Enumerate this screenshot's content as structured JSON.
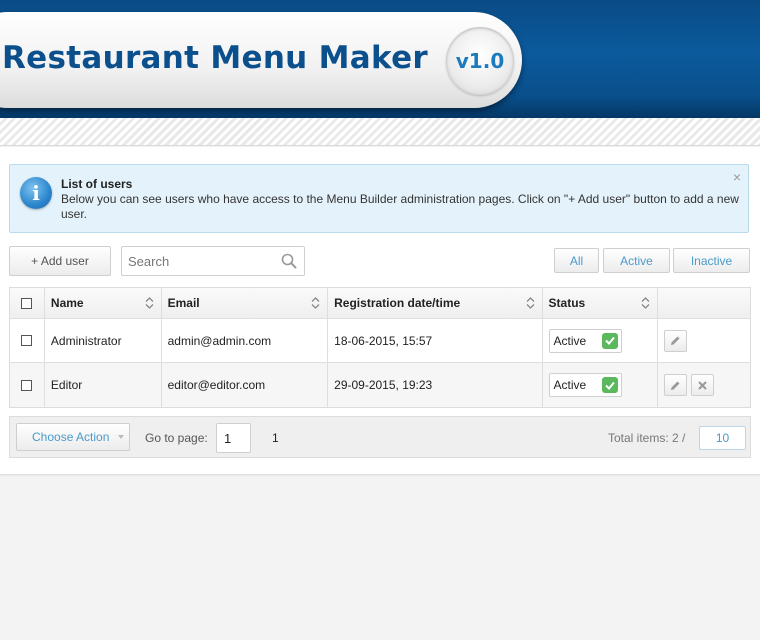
{
  "header": {
    "title": "Restaurant Menu Maker",
    "version": "v1.0"
  },
  "info": {
    "title": "List of users",
    "text": "Below you can see users who have access to the Menu Builder administration pages. Click on \"+ Add user\" button to add a new user.",
    "close_symbol": "×"
  },
  "toolbar": {
    "add_user_label": "+ Add user",
    "search_placeholder": "Search",
    "filters": [
      "All",
      "Active",
      "Inactive"
    ]
  },
  "table": {
    "columns": [
      "Name",
      "Email",
      "Registration date/time",
      "Status"
    ],
    "rows": [
      {
        "name": "Administrator",
        "email": "admin@admin.com",
        "registered": "18-06-2015, 15:57",
        "status": "Active"
      },
      {
        "name": "Editor",
        "email": "editor@editor.com",
        "registered": "29-09-2015, 19:23",
        "status": "Active"
      }
    ]
  },
  "footer": {
    "choose_action_label": "Choose Action",
    "go_to_page_label": "Go to page:",
    "page_value": "1",
    "page_count": "1",
    "total_items_label": "Total items: 2 /",
    "per_page": "10"
  },
  "colors": {
    "header_blue": "#0b5a9c",
    "title_blue": "#0b4f8c",
    "link_blue": "#4a9acb",
    "status_green": "#5cb85c"
  }
}
